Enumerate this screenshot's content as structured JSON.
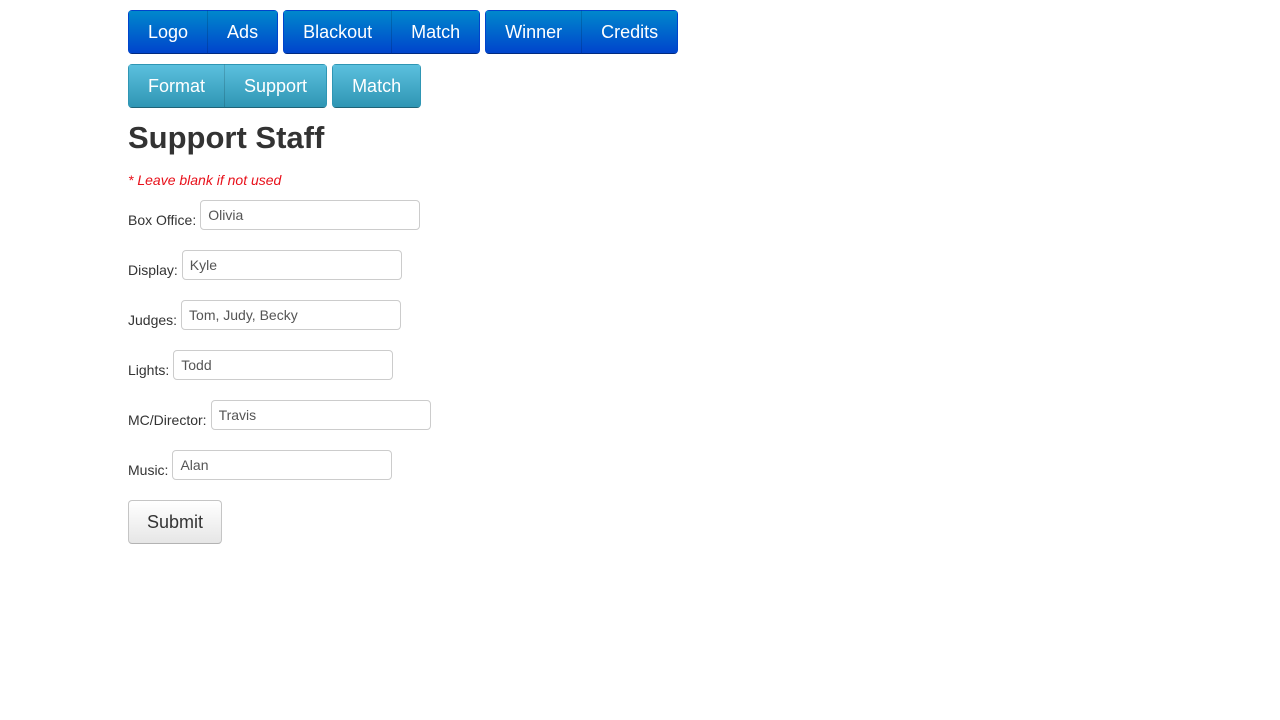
{
  "nav": {
    "row1": [
      {
        "group": [
          "Logo",
          "Ads"
        ]
      },
      {
        "group": [
          "Blackout",
          "Match"
        ]
      },
      {
        "group": [
          "Winner",
          "Credits"
        ]
      }
    ],
    "row2": [
      {
        "group": [
          "Format",
          "Support"
        ]
      },
      {
        "group": [
          "Match"
        ]
      }
    ]
  },
  "colors": {
    "primary": "#0055cc",
    "info": "#49afcd",
    "note": "#e8101a"
  },
  "page": {
    "title": "Support Staff",
    "note": "* Leave blank if not used"
  },
  "form": {
    "fields": [
      {
        "label": "Box Office:",
        "value": "Olivia"
      },
      {
        "label": "Display:",
        "value": "Kyle"
      },
      {
        "label": "Judges:",
        "value": "Tom, Judy, Becky"
      },
      {
        "label": "Lights:",
        "value": "Todd"
      },
      {
        "label": "MC/Director:",
        "value": "Travis"
      },
      {
        "label": "Music:",
        "value": "Alan"
      }
    ],
    "submit_label": "Submit"
  }
}
